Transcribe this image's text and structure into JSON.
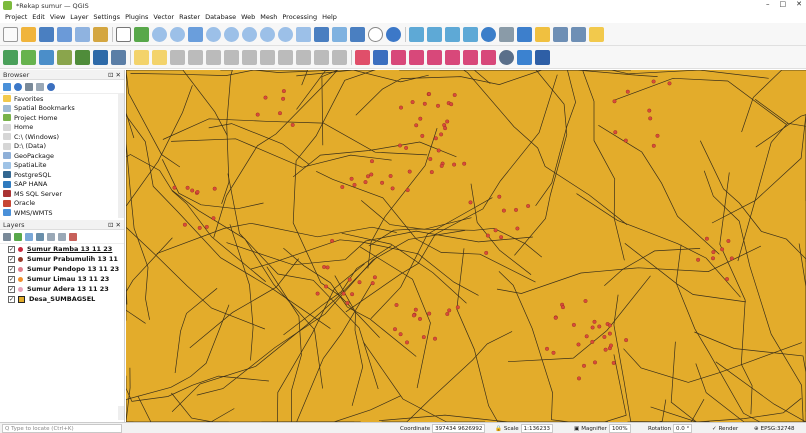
{
  "window": {
    "title": "*Rekap sumur — QGIS",
    "controls": [
      "–",
      "□",
      "✕"
    ]
  },
  "menubar": [
    "Project",
    "Edit",
    "View",
    "Layer",
    "Settings",
    "Plugins",
    "Vector",
    "Raster",
    "Database",
    "Web",
    "Mesh",
    "Processing",
    "Help"
  ],
  "browser": {
    "title": "Browser",
    "items": [
      {
        "label": "Favorites",
        "icon": "star-icon",
        "color": "#f2c94c"
      },
      {
        "label": "Spatial Bookmarks",
        "icon": "bookmark-icon",
        "color": "#9fbad4"
      },
      {
        "label": "Project Home",
        "icon": "folder-icon",
        "color": "#79b34b"
      },
      {
        "label": "Home",
        "icon": "home-folder-icon",
        "color": "#d6d6d6"
      },
      {
        "label": "C:\\ (Windows)",
        "icon": "drive-icon",
        "color": "#d6d6d6"
      },
      {
        "label": "D:\\ (Data)",
        "icon": "drive-icon",
        "color": "#d6d6d6"
      },
      {
        "label": "GeoPackage",
        "icon": "geopackage-icon",
        "color": "#8fb0d8"
      },
      {
        "label": "SpatiaLite",
        "icon": "spatialite-icon",
        "color": "#9fc3e6"
      },
      {
        "label": "PostgreSQL",
        "icon": "postgresql-icon",
        "color": "#336791"
      },
      {
        "label": "SAP HANA",
        "icon": "saphana-icon",
        "color": "#2f7bbf"
      },
      {
        "label": "MS SQL Server",
        "icon": "mssql-icon",
        "color": "#aa3333"
      },
      {
        "label": "Oracle",
        "icon": "oracle-icon",
        "color": "#c74634"
      },
      {
        "label": "WMS/WMTS",
        "icon": "wms-icon",
        "color": "#4a90d9"
      }
    ]
  },
  "layers": {
    "title": "Layers",
    "items": [
      {
        "label": "Sumur Ramba 13 11 23",
        "color": "#c9283e",
        "underline": true
      },
      {
        "label": "Sumur Prabumulih 13 11",
        "color": "#9a3a2a",
        "underline": false
      },
      {
        "label": "Sumur Pendopo 13 11 23",
        "color": "#e07b8a",
        "underline": false
      },
      {
        "label": "Sumur Limau 13 11 23",
        "color": "#f28e2b",
        "underline": false
      },
      {
        "label": "Sumur Adera 13 11 23",
        "color": "#e8a0b8",
        "underline": false
      },
      {
        "label": "Desa_SUMBAGSEL",
        "color": "#e3ac2b",
        "polygon": true,
        "underline": false
      }
    ]
  },
  "map": {
    "background": "#e3ac2b",
    "boundary_color": "#3a2f1a",
    "point_color": "#d94a3a"
  },
  "statusbar": {
    "locate_placeholder": "Q  Type to locate (Ctrl+K)",
    "coordinate_label": "Coordinate",
    "coordinate": "397434  9626992",
    "scale_label": "Scale",
    "scale": "1:136233",
    "magnifier_label": "Magnifier",
    "magnifier": "100%",
    "rotation_label": "Rotation",
    "rotation": "0.0 °",
    "render_label": "Render",
    "crs": "EPSG:32748"
  }
}
